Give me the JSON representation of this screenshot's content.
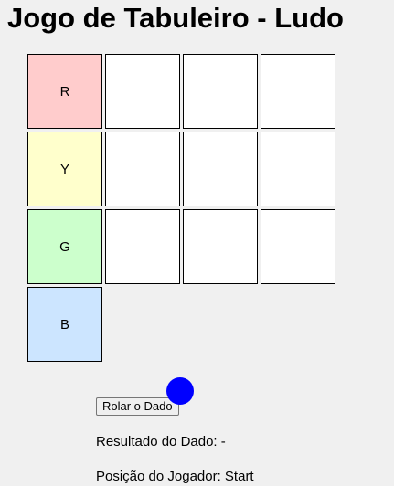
{
  "title": "Jogo de Tabuleiro - Ludo",
  "board": {
    "rows": [
      {
        "start": {
          "label": "R",
          "color": "#ffcccc"
        }
      },
      {
        "start": {
          "label": "Y",
          "color": "#ffffcc"
        }
      },
      {
        "start": {
          "label": "G",
          "color": "#ccffcc"
        }
      },
      {
        "start": {
          "label": "B",
          "color": "#cce5ff"
        }
      }
    ],
    "empty_color": "#ffffff"
  },
  "controls": {
    "roll_button_label": "Rolar o Dado"
  },
  "token": {
    "color": "#0000ff"
  },
  "dice_result_text": "Resultado do Dado: -",
  "player_position_text": "Posição do Jogador: Start"
}
